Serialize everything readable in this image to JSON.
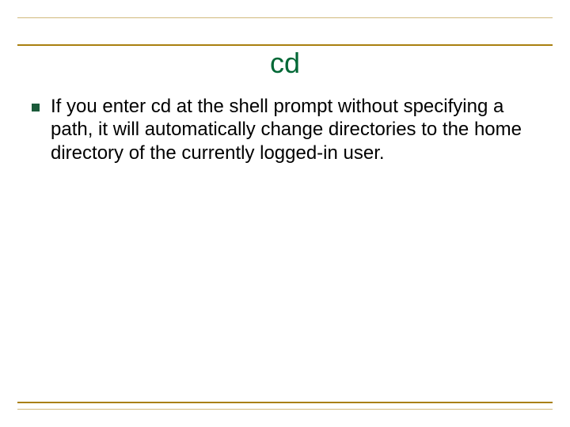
{
  "slide": {
    "title": "cd",
    "bullet": {
      "segments": [
        {
          "text": "If you enter ",
          "weight": "normal"
        },
        {
          "text": "cd",
          "weight": "normal"
        },
        {
          "text": " at the shell prompt without specifying a path, it will automatically change directories to the home directory of the currently logged-in user.",
          "weight": "normal"
        }
      ],
      "plain": "If you enter cd at the shell prompt without specifying a path, it will automatically change directories to the home directory of the currently logged-in user."
    }
  }
}
